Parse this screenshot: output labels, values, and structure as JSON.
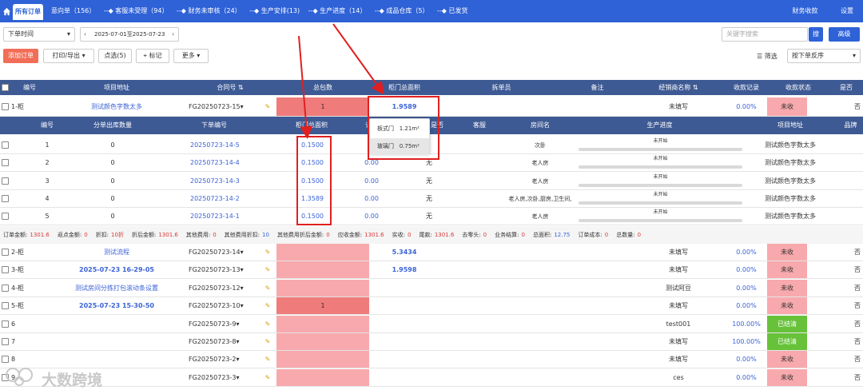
{
  "nav": {
    "active_tab": "所有订单",
    "steps": [
      "意向单（156）",
      "--◆ 客服未受理（94）",
      "--◆ 财务未审核（24）",
      "--◆ 生产安排(13)",
      "--◆ 生产进度（14）",
      "--◆ 成品仓库（5）",
      "--◆ 已发货"
    ],
    "right": [
      "财务收款",
      "设置"
    ]
  },
  "toolbar": {
    "time_select": "下单时间",
    "date_range": "2025-07-01至2025-07-23",
    "search_placeholder": "关键字搜索",
    "search_btn": "搜",
    "advanced": "高级",
    "add_order": "添加订单",
    "print_export": "打印/导出",
    "point_select": "点选(5)",
    "mark": "标记",
    "more": "更多",
    "filter": "筛选",
    "sort": "按下单反序"
  },
  "table": {
    "headers": [
      "编号",
      "项目地址",
      "合同号",
      "总包数",
      "柜门总面积",
      "拆单员",
      "备注",
      "经销商名称",
      "收款记录",
      "收款状态",
      "是否"
    ],
    "rows": [
      {
        "no": "1-柜",
        "addr": "测试颜色字数太多",
        "contract": "FG20250723-15",
        "pkgs": "1",
        "area": "1.9589",
        "dealer": "未填写",
        "pct": "0.00%",
        "status": "未收",
        "yn": "否"
      },
      {
        "no": "2-柜",
        "addr": "测试流程",
        "contract": "FG20250723-14",
        "pkgs": "",
        "area": "5.3434",
        "dealer": "未填写",
        "pct": "0.00%",
        "status": "未收",
        "yn": "否"
      },
      {
        "no": "3-柜",
        "addr": "2025-07-23 16-29-05",
        "contract": "FG20250723-13",
        "pkgs": "",
        "area": "1.9598",
        "dealer": "未填写",
        "pct": "0.00%",
        "status": "未收",
        "yn": "否"
      },
      {
        "no": "4-柜",
        "addr": "测试房间分拣打包滚动条设置",
        "contract": "FG20250723-12",
        "pkgs": "",
        "area": "",
        "dealer": "测试阿豆",
        "pct": "0.00%",
        "status": "未收",
        "yn": "否"
      },
      {
        "no": "5-柜",
        "addr": "2025-07-23 15-30-50",
        "contract": "FG20250723-10",
        "pkgs": "1",
        "area": "",
        "dealer": "未填写",
        "pct": "0.00%",
        "status": "未收",
        "yn": "否"
      },
      {
        "no": "6",
        "addr": "",
        "contract": "FG20250723-9",
        "pkgs": "",
        "area": "",
        "dealer": "test001",
        "pct": "100.00%",
        "status": "已结清",
        "yn": "否"
      },
      {
        "no": "7",
        "addr": "",
        "contract": "FG20250723-8",
        "pkgs": "",
        "area": "",
        "dealer": "未填写",
        "pct": "100.00%",
        "status": "已结清",
        "yn": "否"
      },
      {
        "no": "8",
        "addr": "",
        "contract": "FG20250723-2",
        "pkgs": "",
        "area": "",
        "dealer": "未填写",
        "pct": "0.00%",
        "status": "未收",
        "yn": "否"
      },
      {
        "no": "9",
        "addr": "",
        "contract": "FG20250723-3",
        "pkgs": "",
        "area": "",
        "dealer": "ces",
        "pct": "0.00%",
        "status": "未收",
        "yn": "否"
      }
    ]
  },
  "sub": {
    "headers": [
      "编号",
      "分单出库数量",
      "下单编号",
      "柜门总面积",
      "订单",
      "是否",
      "客服",
      "房间名",
      "生产进度",
      "项目地址",
      "品牌"
    ],
    "rows": [
      {
        "no": "1",
        "qty": "0",
        "code": "20250723-14-5",
        "area": "0.1500",
        "v": "",
        "yn": "",
        "room": "次卧",
        "prog": "未开始",
        "addr": "测试颜色字数太多"
      },
      {
        "no": "2",
        "qty": "0",
        "code": "20250723-14-4",
        "area": "0.1500",
        "v": "0.00",
        "yn": "无",
        "room": "老人房",
        "prog": "未开始",
        "addr": "测试颜色字数太多"
      },
      {
        "no": "3",
        "qty": "0",
        "code": "20250723-14-3",
        "area": "0.1500",
        "v": "0.00",
        "yn": "无",
        "room": "老人房",
        "prog": "未开始",
        "addr": "测试颜色字数太多"
      },
      {
        "no": "4",
        "qty": "0",
        "code": "20250723-14-2",
        "area": "1.3589",
        "v": "0.00",
        "yn": "无",
        "room": "老人房,次卧,厨房,卫生间,",
        "prog": "未开始",
        "addr": "测试颜色字数太多"
      },
      {
        "no": "5",
        "qty": "0",
        "code": "20250723-14-1",
        "area": "0.1500",
        "v": "0.00",
        "yn": "无",
        "room": "老人房",
        "prog": "未开始",
        "addr": "测试颜色字数太多"
      }
    ]
  },
  "summary": {
    "items": [
      [
        "订单金额:",
        "1301.6"
      ],
      [
        "返点金额:",
        "0"
      ],
      [
        "折扣:",
        "10折"
      ],
      [
        "折后金额:",
        "1301.6"
      ],
      [
        "其他费用:",
        "0"
      ],
      [
        "其他费用折扣:",
        "10"
      ],
      [
        "其他费用折后金额:",
        "0"
      ],
      [
        "应收金额:",
        "1301.6"
      ],
      [
        "实收:",
        "0"
      ],
      [
        "尾款:",
        "1301.6"
      ],
      [
        "去零头:",
        "0"
      ],
      [
        "业务结算:",
        "0"
      ],
      [
        "总面积:",
        "12.75"
      ],
      [
        "订单成本:",
        "0"
      ],
      [
        "总数量:",
        "0"
      ]
    ]
  },
  "popup": {
    "items": [
      {
        "label": "板式门",
        "value": "1.21m²"
      },
      {
        "label": "玻璃门",
        "value": "0.75m²"
      }
    ]
  },
  "watermark": "大数跨境",
  "colors": {
    "nav": "#2f62d7",
    "header": "#3e5a94",
    "pink": "#f8a9ad",
    "red": "#ef7b7b",
    "green": "#67c23a",
    "annotation": "#e02020"
  }
}
